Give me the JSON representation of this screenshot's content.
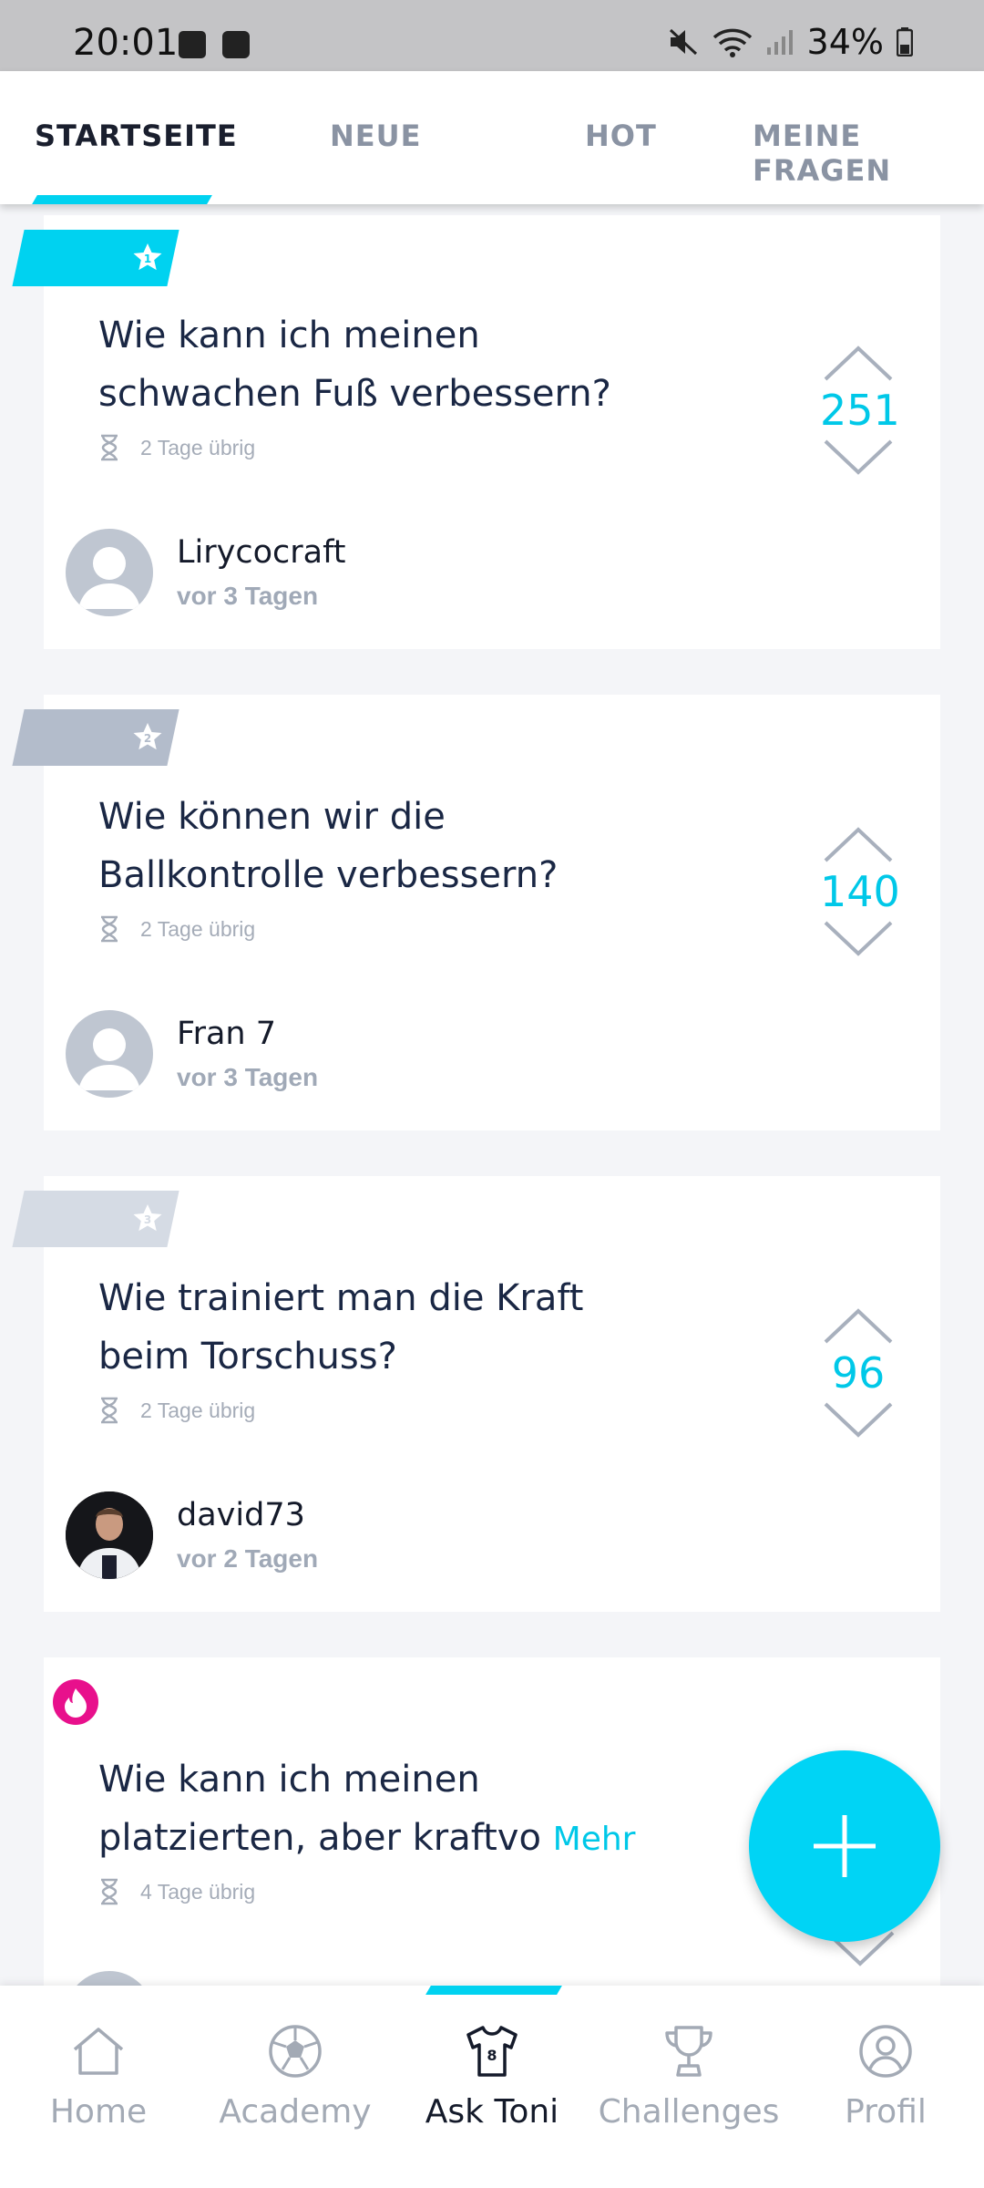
{
  "status_bar": {
    "time": "20:01",
    "battery": "34%"
  },
  "tabs": [
    {
      "label": "STARTSEITE",
      "active": true
    },
    {
      "label": "NEUE",
      "active": false
    },
    {
      "label": "HOT",
      "active": false
    },
    {
      "label": "MEINE FRAGEN",
      "active": false
    }
  ],
  "questions": [
    {
      "rank": "1",
      "title_line1": "Wie kann ich meinen",
      "title_line2": "schwachen Fuß verbessern?",
      "remaining": "2 Tage übrig",
      "votes": "251",
      "author": "Lirycocraft",
      "posted": "vor 3 Tagen"
    },
    {
      "rank": "2",
      "title_line1": "Wie können wir die",
      "title_line2": "Ballkontrolle verbessern?",
      "remaining": "2 Tage übrig",
      "votes": "140",
      "author": "Fran 7",
      "posted": "vor 3 Tagen"
    },
    {
      "rank": "3",
      "title_line1": "Wie trainiert man die Kraft",
      "title_line2": "beim Torschuss?",
      "remaining": "2 Tage übrig",
      "votes": "96",
      "author": "david73",
      "posted": "vor 2 Tagen"
    },
    {
      "title_line1": "Wie kann ich meinen",
      "title_line2": "platzierten, aber kraftvo",
      "more_label": "Mehr",
      "remaining": "4 Tage übrig"
    }
  ],
  "bottom_nav": [
    {
      "label": "Home",
      "icon": "home-icon",
      "active": false
    },
    {
      "label": "Academy",
      "icon": "ball-icon",
      "active": false
    },
    {
      "label": "Ask Toni",
      "icon": "jersey-icon",
      "active": true
    },
    {
      "label": "Challenges",
      "icon": "trophy-icon",
      "active": false
    },
    {
      "label": "Profil",
      "icon": "profile-icon",
      "active": false
    }
  ],
  "colors": {
    "accent": "#00d2f0",
    "rank1": "#00d2f0",
    "rank2": "#b3bccb",
    "rank3": "#d5dbe4",
    "hot": "#e8108c"
  }
}
